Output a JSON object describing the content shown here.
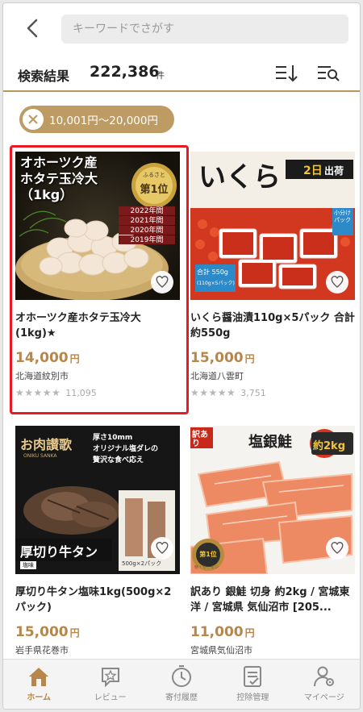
{
  "search": {
    "placeholder": "キーワードでさがす"
  },
  "results": {
    "label": "検索結果",
    "count": "222,386",
    "unit": "件"
  },
  "filter_chip": {
    "label": "10,001円～20,000円"
  },
  "products": [
    {
      "title": "オホーツク産ホタテ玉冷大(1kg)★",
      "price": "14,000",
      "yen": "円",
      "city": "北海道紋別市",
      "stars": "★★★★★",
      "reviews": "11,095",
      "img_text": {
        "line1": "オホーツク産",
        "line2": "ホタテ玉冷大",
        "line3": "（1kg）",
        "badge_top": "ふるさと",
        "badge_main": "第1位",
        "years": [
          "2022年間",
          "2021年間",
          "2020年間",
          "2019年間"
        ]
      }
    },
    {
      "title": "いくら醤油漬110g×5パック 合計約550g",
      "price": "15,000",
      "yen": "円",
      "city": "北海道八雲町",
      "stars": "★★★★★",
      "reviews": "3,751",
      "img_text": {
        "big": "いくら",
        "days": "2日",
        "ship": "出荷",
        "sub": "小分けパック",
        "total": "合計 550g",
        "pack": "(110g×5パック)"
      }
    },
    {
      "title": "厚切り牛タン塩味1kg(500g×2パック)",
      "price": "15,000",
      "yen": "円",
      "city": "岩手県花巻市",
      "img_text": {
        "brand": "お肉讃歌",
        "brand_en": "ONIKU SANKA",
        "desc1": "厚さ10mm",
        "desc2": "オリジナル塩ダレの",
        "desc3": "贅沢な食べ応え",
        "main": "厚切り牛タン",
        "tag": "塩味",
        "pack": "500g×2パック"
      }
    },
    {
      "title": "訳あり 銀鮭 切身 約2kg / 宮城東洋 / 宮城県 気仙沼市 [205...",
      "price": "11,000",
      "yen": "円",
      "city": "宮城県気仙沼市",
      "img_text": {
        "wake": "訳あり",
        "name": "塩銀鮭",
        "weight": "約2kg",
        "medal": "第1位",
        "medal_sub": "鮭・サーモン"
      }
    }
  ],
  "tabs": [
    {
      "label": "ホーム",
      "icon": "home-icon",
      "active": true
    },
    {
      "label": "レビュー",
      "icon": "review-icon",
      "active": false
    },
    {
      "label": "寄付履歴",
      "icon": "history-icon",
      "active": false
    },
    {
      "label": "控除管理",
      "icon": "tax-deduction-icon",
      "active": false
    },
    {
      "label": "マイページ",
      "icon": "mypage-icon",
      "active": false
    }
  ],
  "colors": {
    "accent": "#b7864a",
    "chip": "#bd9b63",
    "highlight": "#e81b24"
  }
}
